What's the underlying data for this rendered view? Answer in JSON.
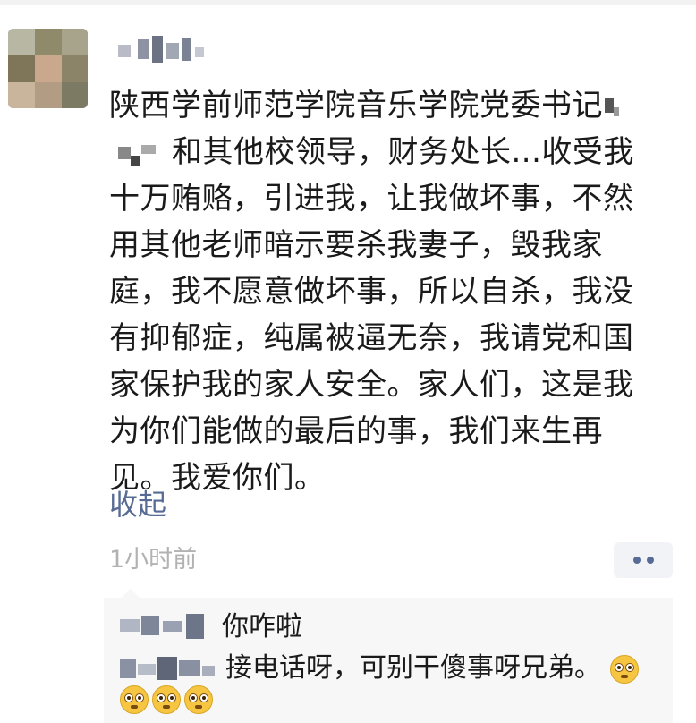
{
  "post": {
    "author_name": "",
    "lines": [
      "陕西学前师范学院音乐学院党委书记",
      "和其他校领导，财务处长...收受我",
      "十万贿赂，引进我，让我做坏事，不然",
      "用其他老师暗示要杀我妻子，毁我家",
      "庭，我不愿意做坏事，所以自杀，我没",
      "有抑郁症，纯属被逼无奈，我请党和国",
      "家保护我的家人安全。家人们，这是我",
      "为你们能做的最后的事，我们来生再",
      "见。我爱你们。"
    ],
    "collapse_label": "收起",
    "timestamp": "1小时前"
  },
  "comments": [
    {
      "text": "你咋啦"
    },
    {
      "text": "接电话呀，可别干傻事呀兄弟。"
    }
  ],
  "icons": {
    "more": "more-dots-icon",
    "emoji": "wide-eyed-face-emoji"
  },
  "colors": {
    "link": "#576b95",
    "text": "#1a1a1a",
    "timestamp": "#b2b2b2",
    "comment_bg": "#f7f7f7"
  }
}
